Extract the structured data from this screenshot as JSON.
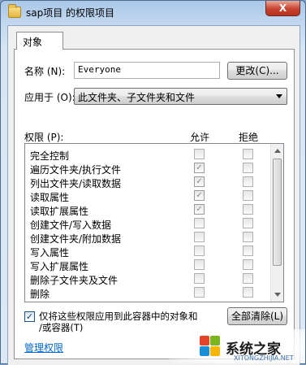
{
  "window": {
    "title": "sap项目 的权限项目",
    "close_glyph": "X",
    "icon": "folder-icon"
  },
  "tab": {
    "label": "对象"
  },
  "name_field": {
    "label": "名称 (N):",
    "value": "Everyone",
    "button": "更改(C)..."
  },
  "apply_to": {
    "label": "应用于 (O):",
    "selected": "此文件夹、子文件夹和文件"
  },
  "permissions": {
    "label": "权限 (P):",
    "allow_header": "允许",
    "deny_header": "拒绝",
    "items": [
      {
        "name": "完全控制",
        "allow": false,
        "deny": false
      },
      {
        "name": "遍历文件夹/执行文件",
        "allow": true,
        "deny": false
      },
      {
        "name": "列出文件夹/读取数据",
        "allow": true,
        "deny": false
      },
      {
        "name": "读取属性",
        "allow": true,
        "deny": false
      },
      {
        "name": "读取扩展属性",
        "allow": true,
        "deny": false
      },
      {
        "name": "创建文件/写入数据",
        "allow": false,
        "deny": false
      },
      {
        "name": "创建文件夹/附加数据",
        "allow": false,
        "deny": false
      },
      {
        "name": "写入属性",
        "allow": false,
        "deny": false
      },
      {
        "name": "写入扩展属性",
        "allow": false,
        "deny": false
      },
      {
        "name": "删除子文件夹及文件",
        "allow": false,
        "deny": false
      },
      {
        "name": "删除",
        "allow": false,
        "deny": false
      }
    ]
  },
  "apply_only": {
    "checked": true,
    "line1": "仅将这些权限应用到此容器中的对象和",
    "line2": "/或容器(T)"
  },
  "clear_all_button": "全部清除(L)",
  "manage_link": "管理权限",
  "watermark": {
    "text": "系统之家",
    "domain": "XITONGZHIJIA.NET"
  }
}
